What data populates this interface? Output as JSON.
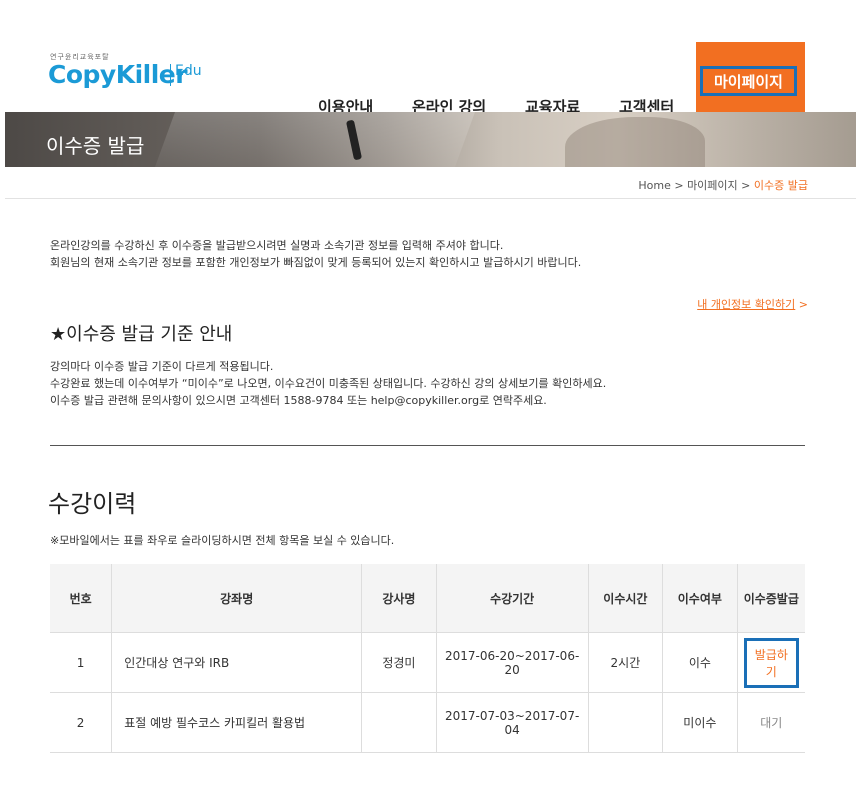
{
  "header": {
    "logo_sub": "연구윤리교육포탈",
    "logo_main": "CopyKiller",
    "logo_edu": "Edu",
    "nav": [
      "이용안내",
      "온라인 강의",
      "교육자료",
      "고객센터"
    ],
    "nav_active": "마이페이지"
  },
  "banner": {
    "title": "이수증 발급"
  },
  "breadcrumb": {
    "home": "Home",
    "sep": ">",
    "mypage": "마이페이지",
    "current": "이수증 발급"
  },
  "intro": {
    "line1": "온라인강의를 수강하신 후 이수증을 발급받으시려면 실명과 소속기관 정보를 입력해 주셔야 합니다.",
    "line2": "회원님의 현재 소속기관 정보를 포함한 개인정보가 빠짐없이 맞게 등록되어 있는지 확인하시고 발급하시기 바랍니다."
  },
  "link_info": "내 개인정보 확인하기",
  "link_info_arrow": ">",
  "notice": {
    "title": "★이수증 발급 기준 안내",
    "line1": "강의마다 이수증 발급 기준이 다르게 적용됩니다.",
    "line2": "수강완료 했는데 이수여부가 “미이수”로 나오면, 이수요건이 미충족된 상태입니다. 수강하신 강의 상세보기를 확인하세요.",
    "line3": "이수증 발급 관련해 문의사항이 있으시면 고객센터 1588-9784 또는 help@copykiller.org로 연락주세요."
  },
  "history": {
    "title": "수강이력",
    "mobile_note": "※모바일에서는 표를 좌우로 슬라이딩하시면 전체 항목을 보실 수 있습니다.",
    "columns": [
      "번호",
      "강좌명",
      "강사명",
      "수강기간",
      "이수시간",
      "이수여부",
      "이수증발급"
    ],
    "rows": [
      {
        "no": "1",
        "course": "인간대상 연구와 IRB",
        "teacher": "정경미",
        "period": "2017-06-20~2017-06-20",
        "hours": "2시간",
        "status": "이수",
        "action": "발급하기"
      },
      {
        "no": "2",
        "course": "표절 예방 필수코스 카피킬러 활용법",
        "teacher": "",
        "period": "2017-07-03~2017-07-04",
        "hours": "",
        "status": "미이수",
        "action": "대기"
      }
    ]
  },
  "colors": {
    "accent": "#f26f21",
    "brand": "#1b9ad6",
    "highlight": "#1a6fb7"
  }
}
